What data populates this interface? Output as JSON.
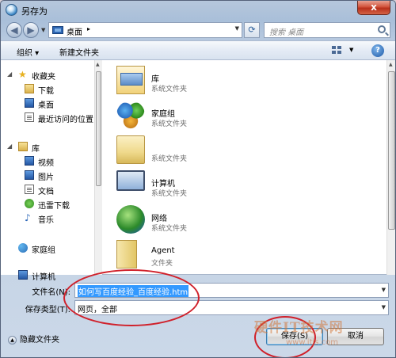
{
  "window": {
    "title": "另存为",
    "close_label": "x"
  },
  "nav": {
    "address_segment": "桌面",
    "address_separator": "▸",
    "search_placeholder": "搜索 桌面"
  },
  "toolbar": {
    "organize_label": "组织 ▾",
    "new_folder_label": "新建文件夹",
    "help_label": "?"
  },
  "sidebar": {
    "favorites": {
      "label": "收藏夹",
      "items": [
        {
          "label": "下载",
          "icon": "download-folder-icon"
        },
        {
          "label": "桌面",
          "icon": "desktop-icon"
        },
        {
          "label": "最近访问的位置",
          "icon": "recent-places-icon"
        }
      ]
    },
    "libraries": {
      "label": "库",
      "items": [
        {
          "label": "视频",
          "icon": "video-library-icon"
        },
        {
          "label": "图片",
          "icon": "pictures-library-icon"
        },
        {
          "label": "文档",
          "icon": "documents-library-icon"
        },
        {
          "label": "迅雷下载",
          "icon": "thunder-download-icon"
        },
        {
          "label": "音乐",
          "icon": "music-library-icon"
        }
      ]
    },
    "homegroup": {
      "label": "家庭组"
    },
    "computer": {
      "label": "计算机"
    }
  },
  "files": [
    {
      "name": "库",
      "type": "系统文件夹",
      "icon": "libraries-icon"
    },
    {
      "name": "家庭组",
      "type": "系统文件夹",
      "icon": "homegroup-icon"
    },
    {
      "name": "",
      "type": "系统文件夹",
      "icon": "user-folder-icon"
    },
    {
      "name": "计算机",
      "type": "系统文件夹",
      "icon": "computer-icon"
    },
    {
      "name": "网络",
      "type": "系统文件夹",
      "icon": "network-icon"
    },
    {
      "name": "Agent",
      "type": "文件夹",
      "icon": "folder-icon"
    }
  ],
  "form": {
    "filename_label": "文件名(N):",
    "filename_value": "如何写百度经验_百度经验.htm",
    "filetype_label": "保存类型(T):",
    "filetype_value": "网页，全部"
  },
  "bottom": {
    "hide_folders_label": "隐藏文件夹",
    "save_label": "保存(S)",
    "cancel_label": "取消"
  },
  "watermark": {
    "text": "硬件IT技术网",
    "sub": "www.itjs.com"
  },
  "colors": {
    "annotation": "#d0202a",
    "selection": "#3399ff"
  }
}
